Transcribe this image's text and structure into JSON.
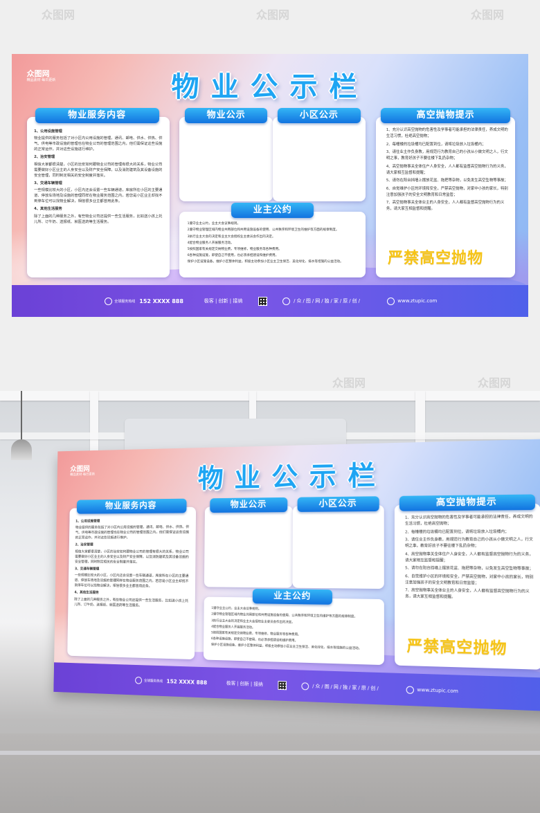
{
  "watermark_text": "众图网",
  "logo": {
    "name": "众图网",
    "tagline": "精品素材·每日更新"
  },
  "title": "物业公示栏",
  "sections": {
    "service": {
      "heading": "物业服务内容",
      "items": [
        {
          "heading": "1、公用设施管理",
          "body": "物业提供的服务包括了对小区内公用设施的管理，通讯、邮电、供水、供热、供气、供电等市政设施的管理也在物业公司的管理范围之内，他们需保证这些设施的正常运作，并对这些设施进行维护。"
        },
        {
          "heading": "2、治安管理",
          "body": "相信大家都很清楚，小区的治安如何跟物业公司的管理有很大的关系，物业公司需要做好小区业主的人身安全以及财产安全保障，以及消防建筑及其设备设施的安全管理，同时制定相关的安全制度并落实。"
        },
        {
          "heading": "3、交通车辆管理",
          "body": "一些规模比较大的小区，小区内还会设置一些车辆通道，库房所在小区的主要通道、停放车场地及设施的管理同样在物业服务范围之内，若您是小区业主却找不到停车位可以找物业解决，相信很多业主都曾用此条。"
        },
        {
          "heading": "4、其他生活服务",
          "body": "除了上面的几种服务之外，有些物业公司还提供一些生活服务，比如送小孩上托儿所、订牛奶、送报纸、就医送药等生活服务。"
        }
      ]
    },
    "property": {
      "heading": "物业公示"
    },
    "community": {
      "heading": "小区公示"
    },
    "owners": {
      "heading": "业主公约",
      "items": [
        "1遵守业主公约，业主大会议事规则。",
        "2遵守物业管理区域内物业共用部位和共用设施设备的使用、公共秩序和环境卫生的维护等方面的规章制度。",
        "3执行业主大会的决定和业主大会授权业主委员会作出的决定。",
        "4配合物业服务人开展服务活动。",
        "5按照国家有关规定交纳物业费，专项维修，物业服务等各种费用。",
        "6各种设施设施，即使自己不使用，也必须承担建设和维护费用。",
        "保护小区设施设备，维护小区整体利益，积极主动参加小区业主卫生保洁、美化绿化、排水等措施的公益活动。"
      ]
    },
    "highrise": {
      "heading": "高空抛物提示",
      "items": [
        "1、充分认识高空抛物的危害性及学事者可能承担的法律责任，养成文明的生活习惯，杜绝高空抛物；",
        "2、每幢楼的垃圾桶均已配置到位，请将垃圾放入垃圾桶内；",
        "3、请住业主作负身教，用规范行为教育自己的小孩从小做文明之人，行文明之事，教育好孩子不要往楼下乱扔杂物；",
        "4、高空抛物事关全体住户人身安全，人人都有监督高空抛物行为的义务，请大家相互监督和提醒；",
        "5、请勿在阳台挡墙上摆放花盆、拖把等杂物，以免发生高空坠物等事故；",
        "6、自觉维护小区的环境和安全，严禁高空抛物，对家中小孩的家长，特别注意加强孩子的安全文明教育和日常监管；",
        "7、高空抛物事关全体业主的人身安全，人人都有监督高空抛物行为的义务，请大家互相监督和提醒。"
      ],
      "slogan": "严禁高空抛物"
    }
  },
  "footer": {
    "hotline_label": "全球服务热线",
    "phone": "152 XXXX 888",
    "tags": "极客 | 创新 | 接纳",
    "nav": "/众/图/网/独/家/原/创/",
    "url": "www.ztupic.com"
  },
  "colors": {
    "title": "#1ea5f3",
    "pill": "#1273e0",
    "slogan": "#f6c416",
    "footer": "#6b41d6"
  }
}
